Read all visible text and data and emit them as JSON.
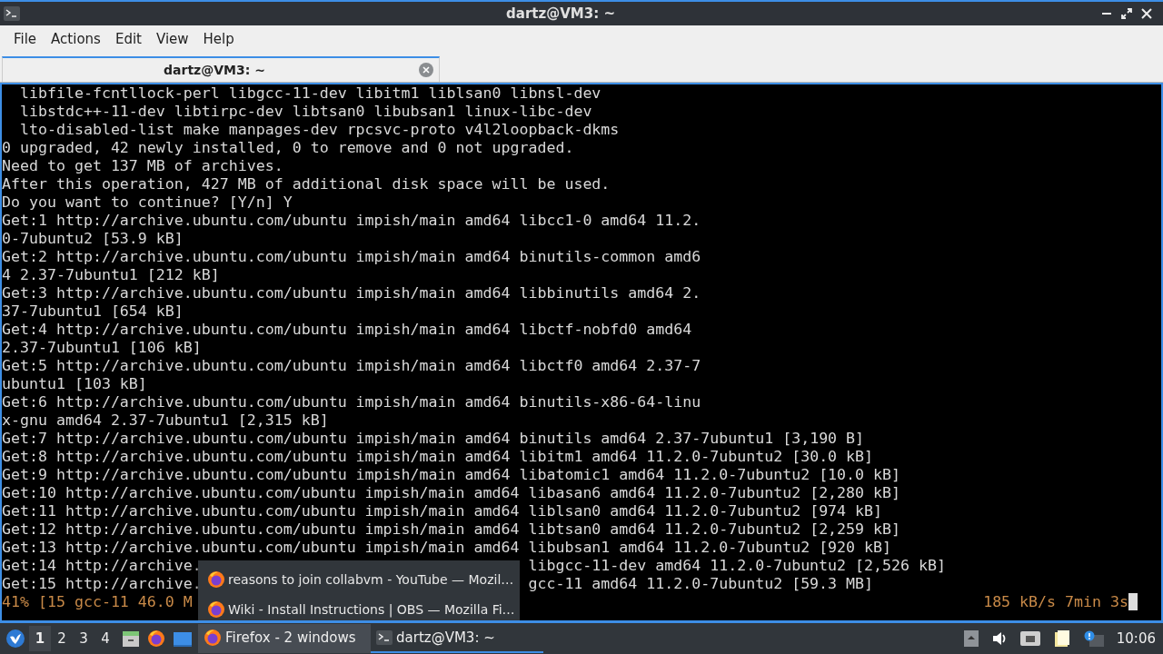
{
  "window": {
    "title": "dartz@VM3: ~"
  },
  "menu": [
    "File",
    "Actions",
    "Edit",
    "View",
    "Help"
  ],
  "tabs": [
    {
      "label": "dartz@VM3: ~",
      "selected": true
    }
  ],
  "terminal": {
    "lines": [
      {
        "text": "  libfile-fcntllock-perl libgcc-11-dev libitm1 liblsan0 libnsl-dev"
      },
      {
        "text": "  libstdc++-11-dev libtirpc-dev libtsan0 libubsan1 linux-libc-dev"
      },
      {
        "text": "  lto-disabled-list make manpages-dev rpcsvc-proto v4l2loopback-dkms"
      },
      {
        "text": "0 upgraded, 42 newly installed, 0 to remove and 0 not upgraded."
      },
      {
        "text": "Need to get 137 MB of archives."
      },
      {
        "text": "After this operation, 427 MB of additional disk space will be used."
      },
      {
        "text": "Do you want to continue? [Y/n] Y"
      },
      {
        "text": "Get:1 http://archive.ubuntu.com/ubuntu impish/main amd64 libcc1-0 amd64 11.2."
      },
      {
        "text": "0-7ubuntu2 [53.9 kB]"
      },
      {
        "text": "Get:2 http://archive.ubuntu.com/ubuntu impish/main amd64 binutils-common amd6"
      },
      {
        "text": "4 2.37-7ubuntu1 [212 kB]"
      },
      {
        "text": "Get:3 http://archive.ubuntu.com/ubuntu impish/main amd64 libbinutils amd64 2."
      },
      {
        "text": "37-7ubuntu1 [654 kB]"
      },
      {
        "text": "Get:4 http://archive.ubuntu.com/ubuntu impish/main amd64 libctf-nobfd0 amd64"
      },
      {
        "text": "2.37-7ubuntu1 [106 kB]"
      },
      {
        "text": "Get:5 http://archive.ubuntu.com/ubuntu impish/main amd64 libctf0 amd64 2.37-7"
      },
      {
        "text": "ubuntu1 [103 kB]"
      },
      {
        "text": "Get:6 http://archive.ubuntu.com/ubuntu impish/main amd64 binutils-x86-64-linu"
      },
      {
        "text": "x-gnu amd64 2.37-7ubuntu1 [2,315 kB]"
      },
      {
        "text": "Get:7 http://archive.ubuntu.com/ubuntu impish/main amd64 binutils amd64 2.37-7ubuntu1 [3,190 B]"
      },
      {
        "text": "Get:8 http://archive.ubuntu.com/ubuntu impish/main amd64 libitm1 amd64 11.2.0-7ubuntu2 [30.0 kB]"
      },
      {
        "text": "Get:9 http://archive.ubuntu.com/ubuntu impish/main amd64 libatomic1 amd64 11.2.0-7ubuntu2 [10.0 kB]"
      },
      {
        "text": "Get:10 http://archive.ubuntu.com/ubuntu impish/main amd64 libasan6 amd64 11.2.0-7ubuntu2 [2,280 kB]"
      },
      {
        "text": "Get:11 http://archive.ubuntu.com/ubuntu impish/main amd64 liblsan0 amd64 11.2.0-7ubuntu2 [974 kB]"
      },
      {
        "text": "Get:12 http://archive.ubuntu.com/ubuntu impish/main amd64 libtsan0 amd64 11.2.0-7ubuntu2 [2,259 kB]"
      },
      {
        "text": "Get:13 http://archive.ubuntu.com/ubuntu impish/main amd64 libubsan1 amd64 11.2.0-7ubuntu2 [920 kB]"
      },
      {
        "text": "Get:14 http://archive.",
        "rest": "libgcc-11-dev amd64 11.2.0-7ubuntu2 [2,526 kB]"
      },
      {
        "text": "Get:15 http://archive.",
        "rest": "gcc-11 amd64 11.2.0-7ubuntu2 [59.3 MB]"
      },
      {
        "kind": "progress",
        "text": "41% [15 gcc-11 46.0 M",
        "rest": "185 kB/s 7min 3s"
      }
    ]
  },
  "popup": {
    "items": [
      "reasons to join collabvm - YouTube — Mozil…",
      "Wiki - Install Instructions | OBS — Mozilla Fi…"
    ]
  },
  "taskbar": {
    "workspaces": [
      {
        "label": "1",
        "selected": true
      },
      {
        "label": "2",
        "selected": false
      },
      {
        "label": "3",
        "selected": false
      },
      {
        "label": "4",
        "selected": false
      }
    ],
    "tasks": [
      {
        "kind": "browser",
        "label": "Firefox - 2 windows",
        "selected": false,
        "expanded": true
      },
      {
        "kind": "terminal",
        "label": "dartz@VM3: ~",
        "selected": true,
        "expanded": false
      }
    ],
    "clock": "10:06"
  }
}
